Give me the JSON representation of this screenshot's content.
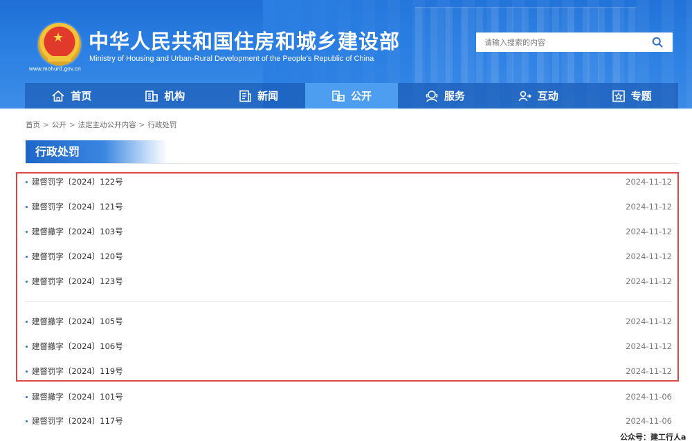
{
  "header": {
    "title_cn": "中华人民共和国住房和城乡建设部",
    "title_en": "Ministry of Housing and Urban-Rural Development of the People’s Republic of China",
    "url": "www.mohurd.gov.cn",
    "search_placeholder": "请输入搜索的内容"
  },
  "nav": {
    "items": [
      {
        "label": "首页",
        "icon": "home-icon"
      },
      {
        "label": "机构",
        "icon": "building-icon"
      },
      {
        "label": "新闻",
        "icon": "news-icon"
      },
      {
        "label": "公开",
        "icon": "public-info-icon"
      },
      {
        "label": "服务",
        "icon": "service-icon"
      },
      {
        "label": "互动",
        "icon": "interact-icon"
      },
      {
        "label": "专题",
        "icon": "topic-icon"
      }
    ],
    "active_index": 3
  },
  "breadcrumb": {
    "items": [
      "首页",
      "公开",
      "法定主动公开内容",
      "行政处罚"
    ],
    "separator": ">"
  },
  "section": {
    "title": "行政处罚"
  },
  "list": {
    "items": [
      {
        "title": "建督罚字〔2024〕122号",
        "date": "2024-11-12"
      },
      {
        "title": "建督罚字〔2024〕121号",
        "date": "2024-11-12"
      },
      {
        "title": "建督撤字〔2024〕103号",
        "date": "2024-11-12"
      },
      {
        "title": "建督罚字〔2024〕120号",
        "date": "2024-11-12"
      },
      {
        "title": "建督罚字〔2024〕123号",
        "date": "2024-11-12"
      },
      {
        "title": "建督撤字〔2024〕105号",
        "date": "2024-11-12"
      },
      {
        "title": "建督撤字〔2024〕106号",
        "date": "2024-11-12"
      },
      {
        "title": "建督罚字〔2024〕119号",
        "date": "2024-11-12"
      },
      {
        "title": "建督撤字〔2024〕101号",
        "date": "2024-11-06"
      },
      {
        "title": "建督罚字〔2024〕117号",
        "date": "2024-11-06"
      }
    ]
  },
  "watermark": "公众号：建工行人a",
  "colors": {
    "brand_blue": "#2b7fe2",
    "nav_active": "#4d9df0",
    "highlight_red": "#e0443e"
  }
}
